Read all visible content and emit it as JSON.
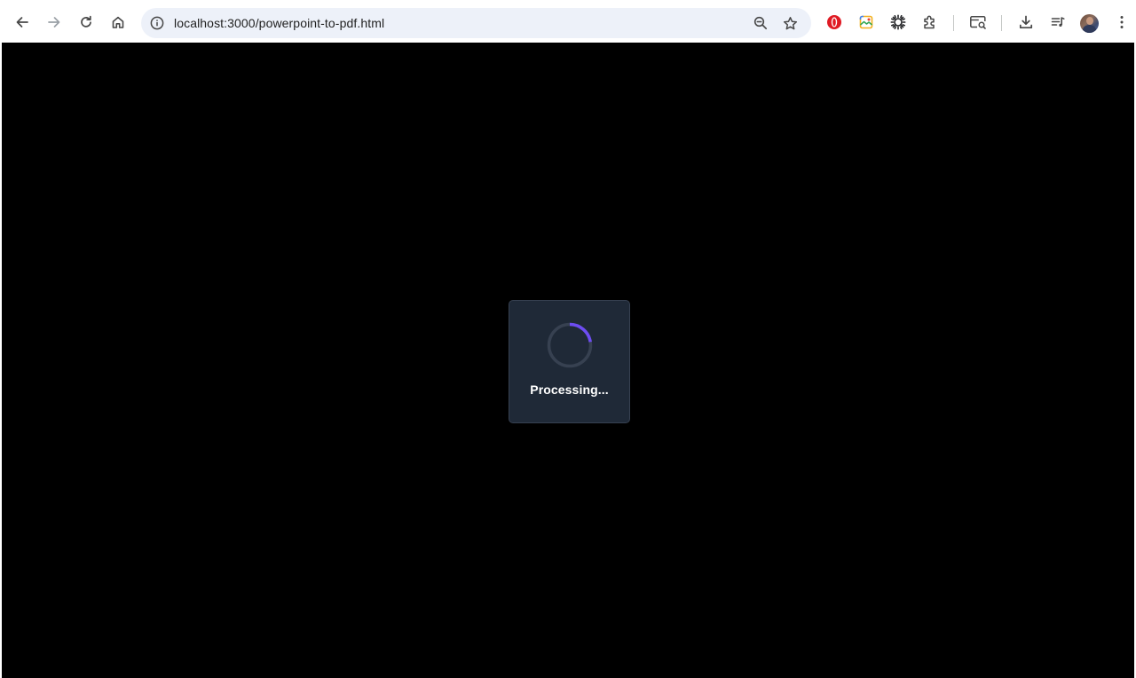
{
  "browser": {
    "url": "localhost:3000/powerpoint-to-pdf.html",
    "icons": {
      "back": "arrow-left-icon",
      "forward": "arrow-right-icon",
      "reload": "reload-icon",
      "home": "home-icon",
      "site_info": "info-icon",
      "zoom": "zoom-out-icon",
      "bookmark": "star-icon",
      "extension_1": "opera-icon",
      "extension_2": "colorful-picture-icon",
      "extension_3": "sun-icon",
      "extensions": "puzzle-icon",
      "search_tab": "tab-search-icon",
      "downloads": "download-icon",
      "media": "media-queue-icon",
      "profile": "avatar",
      "menu": "kebab-menu-icon"
    }
  },
  "loading": {
    "label": "Processing..."
  },
  "colors": {
    "page_background": "#000000",
    "modal_background": "#1f2937",
    "spinner_track": "#374151",
    "spinner_accent": "#6d4cf2"
  }
}
